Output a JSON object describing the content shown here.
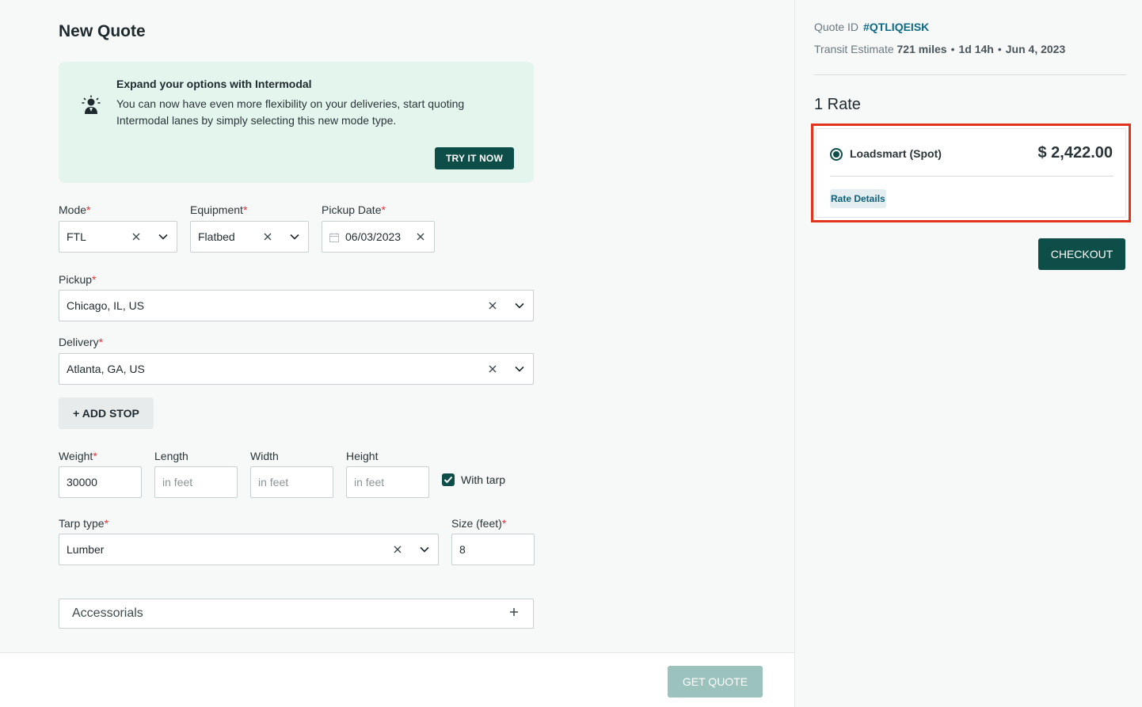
{
  "page": {
    "title": "New Quote"
  },
  "promo": {
    "icon": "person-highlight-icon",
    "title": "Expand your options with Intermodal",
    "body": "You can now have even more flexibility on your deliveries, start quoting Intermodal lanes by simply selecting this new mode type.",
    "button": "TRY IT NOW"
  },
  "form": {
    "required_mark": "*",
    "mode": {
      "label": "Mode",
      "value": "FTL"
    },
    "equipment": {
      "label": "Equipment",
      "value": "Flatbed"
    },
    "pickup_date": {
      "label": "Pickup Date",
      "value": "06/03/2023"
    },
    "pickup": {
      "label": "Pickup",
      "value": "Chicago, IL, US"
    },
    "delivery": {
      "label": "Delivery",
      "value": "Atlanta, GA, US"
    },
    "add_stop": "+ ADD STOP",
    "weight": {
      "label": "Weight",
      "value": "30000"
    },
    "length": {
      "label": "Length",
      "placeholder": "in feet"
    },
    "width": {
      "label": "Width",
      "placeholder": "in feet"
    },
    "height": {
      "label": "Height",
      "placeholder": "in feet"
    },
    "with_tarp": {
      "label": "With tarp",
      "checked": true
    },
    "tarp_type": {
      "label": "Tarp type",
      "value": "Lumber"
    },
    "size": {
      "label": "Size (feet)",
      "value": "8"
    },
    "accessorials": "Accessorials",
    "get_quote": "GET QUOTE"
  },
  "summary": {
    "quote_id_label": "Quote ID",
    "quote_id": "#QTLIQEISK",
    "transit_label": "Transit Estimate",
    "miles": "721 miles",
    "duration": "1d 14h",
    "date": "Jun 4, 2023",
    "rate_count": "1 Rate",
    "rates": [
      {
        "carrier": "Loadsmart (Spot)",
        "price": "$ 2,422.00",
        "details": "Rate Details",
        "selected": true
      }
    ],
    "checkout": "CHECKOUT"
  },
  "colors": {
    "primary": "#0d4f48",
    "promo_bg": "#e3f5ec",
    "highlight": "#e2341d",
    "link": "#0d6a86"
  }
}
